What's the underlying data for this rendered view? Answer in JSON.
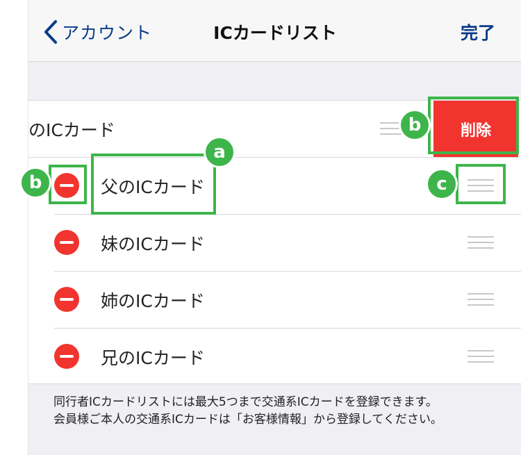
{
  "navbar": {
    "back_label": "アカウント",
    "title": "ICカードリスト",
    "done_label": "完了"
  },
  "list": {
    "swiped_row": {
      "label": "のICカード",
      "delete_label": "削除"
    },
    "rows": [
      {
        "label": "父のICカード"
      },
      {
        "label": "妹のICカード"
      },
      {
        "label": "姉のICカード"
      },
      {
        "label": "兄のICカード"
      }
    ]
  },
  "footer": {
    "line1": "同行者ICカードリストには最大5つまで交通系ICカードを登録できます。",
    "line2": "会員様ご本人の交通系ICカードは「お客様情報」から登録してください。"
  },
  "annotations": {
    "a": "a",
    "b": "b",
    "c": "c"
  },
  "colors": {
    "accent_blue": "#0a3b88",
    "delete_red": "#f2342f",
    "annotation_green": "#3db54a",
    "grouped_background": "#efeff4"
  }
}
